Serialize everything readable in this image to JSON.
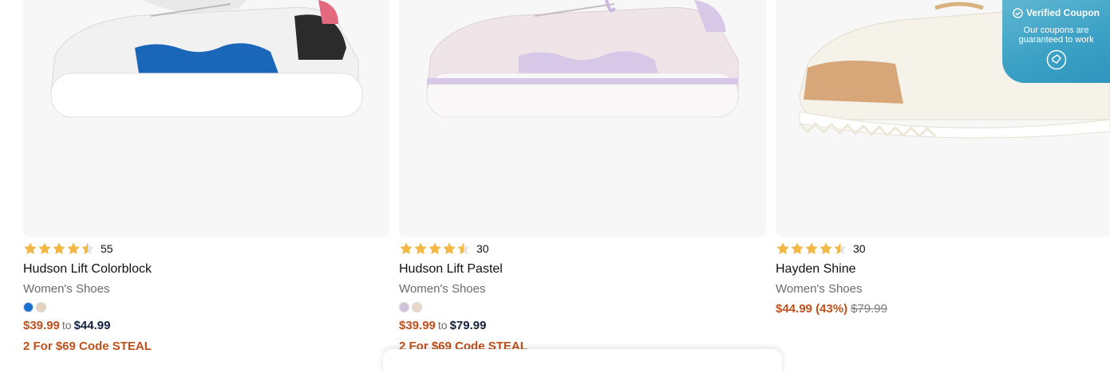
{
  "products": [
    {
      "title": "Hudson Lift Colorblock",
      "subtitle": "Women's Shoes",
      "rating": 4.5,
      "review_count": "55",
      "swatches": [
        "#1a6fd1",
        "#e6d3bf"
      ],
      "price_from": "$39.99",
      "price_to_word": "to",
      "price_to": "$44.99",
      "promo": "2 For $69 Code STEAL",
      "accent_color": "#1a66b8"
    },
    {
      "title": "Hudson Lift Pastel",
      "subtitle": "Women's Shoes",
      "rating": 4.5,
      "review_count": "30",
      "swatches": [
        "#cfc3d9",
        "#ead8c6"
      ],
      "price_from": "$39.99",
      "price_to_word": "to",
      "price_to": "$79.99",
      "promo": "2 For $69 Code STEAL",
      "accent_color": "#d6c8e6"
    },
    {
      "title": "Hayden Shine",
      "subtitle": "Women's Shoes",
      "rating": 4.5,
      "review_count": "30",
      "sale_price": "$44.99",
      "discount": "(43%)",
      "original_price": "$79.99",
      "accent_color": "#d7a77a"
    }
  ],
  "coupon": {
    "title": "Verified Coupon",
    "subtitle": "Our coupons are guaranteed to work",
    "icon": "coupon-badge-icon"
  },
  "colors": {
    "star": "#f3b843",
    "sale_price": "#c0501c",
    "coupon_bg": "#3aa0c4"
  }
}
